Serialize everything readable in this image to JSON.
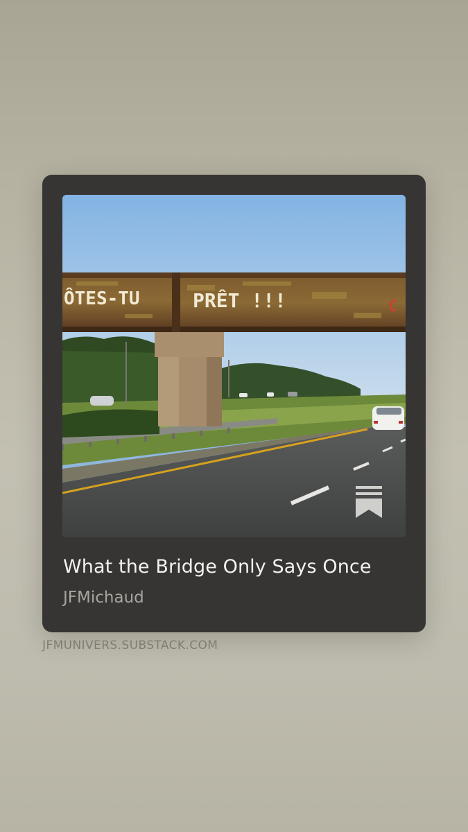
{
  "post": {
    "title": "What the Bridge Only Says Once",
    "author": "JFMichaud",
    "domain": "JFMUNIVERS.SUBSTACK.COM",
    "image": {
      "description_icon": "bridge-photo",
      "graffiti_left": "ÔTES-TU",
      "graffiti_right": "PRÊT !!!"
    },
    "save_icon": "bookmark-icon"
  },
  "colors": {
    "card": "#363533",
    "title": "#f3f2ee",
    "author": "#a7a59f",
    "domain": "#807d74"
  }
}
